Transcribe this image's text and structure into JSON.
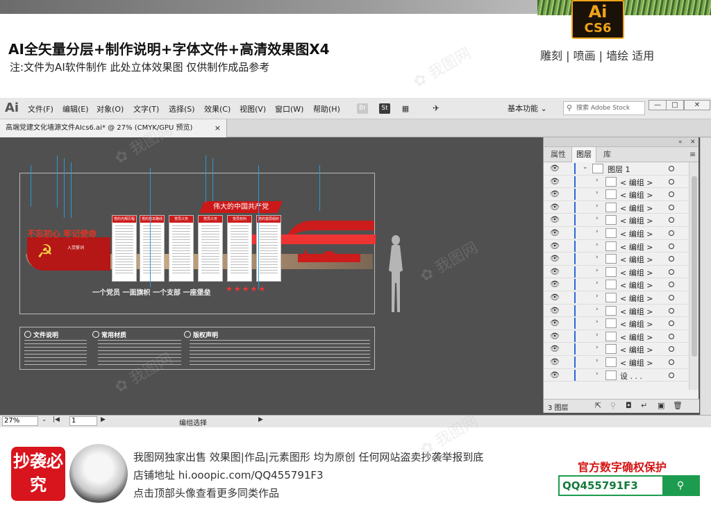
{
  "banner": {
    "badge_ai": "Ai",
    "badge_version": "CS6",
    "headline": "AI全矢量分层+制作说明+字体文件+高清效果图X4",
    "subline": "注:文件为AI软件制作 此处立体效果图 仅供制作成品参考",
    "tags": "雕刻 | 喷画 | 墙绘 适用"
  },
  "app": {
    "logo": "Ai",
    "menu": [
      "文件(F)",
      "编辑(E)",
      "对象(O)",
      "文字(T)",
      "选择(S)",
      "效果(C)",
      "视图(V)",
      "窗口(W)",
      "帮助(H)"
    ],
    "bridge_icon": "Br",
    "stock_icon": "St",
    "workspace": "基本功能",
    "stock_search_placeholder": "搜索 Adobe Stock",
    "window_buttons": [
      "—",
      "□",
      "✕"
    ],
    "doc_tab": "高端党建文化墙源文件AIcs6.ai* @ 27% (CMYK/GPU 预览)",
    "doc_tab_close": "×"
  },
  "artwork": {
    "slogan_left": "不忘初心 牢记使命",
    "oath_label": "入党誓词",
    "banner": "伟大的中国共产党",
    "panels": [
      "党的光辉历程",
      "党的基本路线",
      "党员义务",
      "党员义务",
      "党员权利",
      "党的基层组织"
    ],
    "bottom_slogan": "一个党员 一面旗帜 一个支部 一座堡垒",
    "stars": "★★★★★",
    "notes_heads": [
      "文件说明",
      "常用材质",
      "版权声明"
    ]
  },
  "layers_panel": {
    "tabs": [
      "属性",
      "图层",
      "库"
    ],
    "active_tab": "图层",
    "top_layer": "图层 1",
    "rows": [
      "< 编组 >",
      "< 编组 >",
      "< 编组 >",
      "< 编组 >",
      "< 编组 >",
      "< 编组 >",
      "< 编组 >",
      "< 编组 >",
      "< 编组 >",
      "< 编组 >",
      "< 编组 >",
      "< 编组 >",
      "< 编组 >",
      "< 编组 >",
      "< 编组 >"
    ],
    "last_row": "设 . . .",
    "count": "3 图层"
  },
  "status": {
    "zoom": "27%",
    "page": "1",
    "text": "编组选择"
  },
  "footer": {
    "seal": "抄袭必究",
    "line1": "我图网独家出售 效果图|作品|元素图形 均为原创 任何网站盗卖抄袭举报到底",
    "line2": "店铺地址 hi.ooopic.com/QQ455791F3",
    "line3": "点击顶部头像查看更多同类作品",
    "protect_title": "官方数字确权保护",
    "qq_value": "QQ455791F3"
  },
  "colors": {
    "accent_red": "#cc1c1c",
    "app_dark": "#535353",
    "qq_green": "#1d9c4f",
    "badge_orange": "#f0a318"
  }
}
